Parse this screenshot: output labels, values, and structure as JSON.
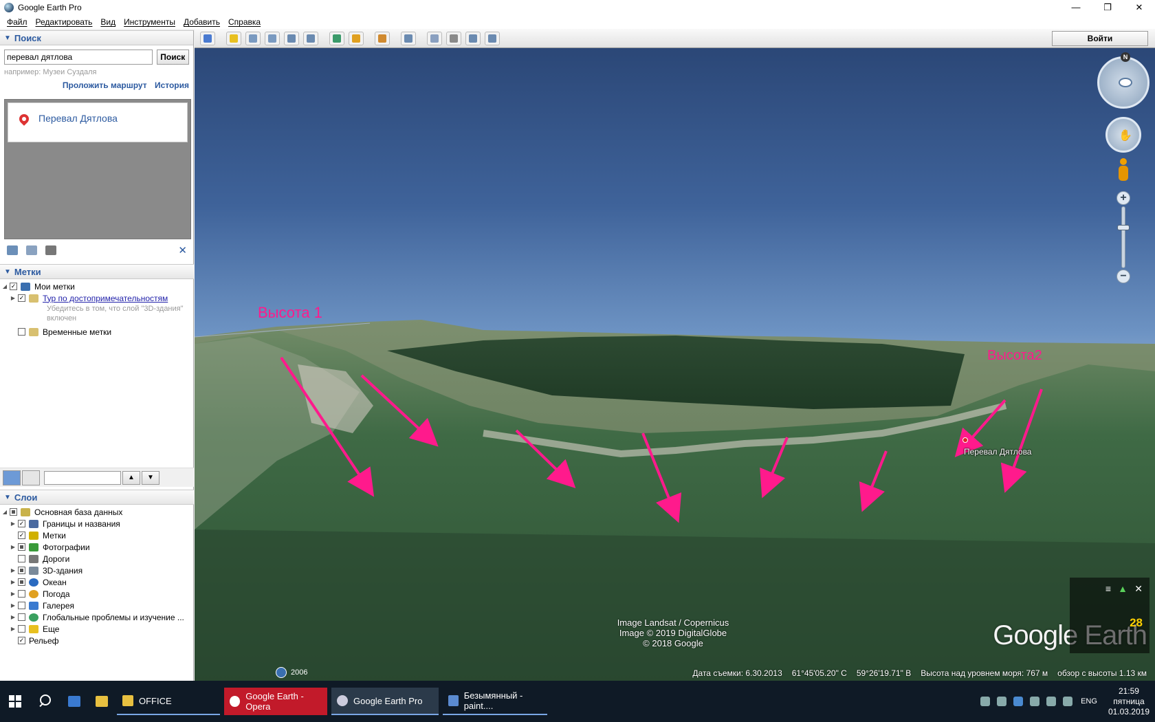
{
  "window": {
    "title": "Google Earth Pro",
    "controls": [
      "—",
      "❐",
      "✕"
    ]
  },
  "menu": [
    "Файл",
    "Редактировать",
    "Вид",
    "Инструменты",
    "Добавить",
    "Справка"
  ],
  "search": {
    "header": "Поиск",
    "query": "перевал дятлова",
    "button": "Поиск",
    "hint": "например: Музеи Суздаля",
    "link_route": "Проложить маршрут",
    "link_history": "История",
    "result": "Перевал Дятлова"
  },
  "places": {
    "header": "Метки",
    "my_places": "Мои метки",
    "tour_link": "Тур по достопримечательностям",
    "tour_note_1": "Убедитесь в том, что слой \"3D-здания\"",
    "tour_note_2": "включен",
    "temporary": "Временные метки"
  },
  "layers": {
    "header": "Слои",
    "items": [
      {
        "label": "Основная база данных",
        "icon": "database-icon",
        "color": "#c9b24a"
      },
      {
        "label": "Границы и названия",
        "icon": "borders-icon",
        "color": "#4a6aa0"
      },
      {
        "label": "Метки",
        "icon": "placemark-icon",
        "color": "#d0b000"
      },
      {
        "label": "Фотографии",
        "icon": "photo-icon",
        "color": "#3a9a3a"
      },
      {
        "label": "Дороги",
        "icon": "road-icon",
        "color": "#777777"
      },
      {
        "label": "3D-здания",
        "icon": "building-icon",
        "color": "#7a8a9a"
      },
      {
        "label": "Океан",
        "icon": "ocean-icon",
        "color": "#2a6ac0"
      },
      {
        "label": "Погода",
        "icon": "weather-icon",
        "color": "#e0a020"
      },
      {
        "label": "Галерея",
        "icon": "gallery-icon",
        "color": "#3a7ad0"
      },
      {
        "label": "Глобальные проблемы и изучение ...",
        "icon": "globe-icon",
        "color": "#3aa060"
      },
      {
        "label": "Еще",
        "icon": "more-icon",
        "color": "#e8c020"
      },
      {
        "label": "Рельеф",
        "icon": "",
        "color": ""
      }
    ]
  },
  "toolbar": {
    "signin": "Войти"
  },
  "map": {
    "annotation_1": "Высота 1",
    "annotation_2": "Высота2",
    "place_label": "Перевал Дятлова",
    "credit_1": "Image Landsat / Copernicus",
    "credit_2": "Image © 2019 DigitalGlobe",
    "credit_3": "© 2018 Google",
    "logo": "Google Earth",
    "historical_year": "2006",
    "compass_letter": "N",
    "mini_count": "28"
  },
  "status": {
    "date": "Дата съемки: 6.30.2013",
    "lat": "61°45'05.20\" С",
    "lon": "59°26'19.71\" В",
    "elevation": "Высота над уровнем моря:   767 м",
    "eye_alt": "обзор с высоты   1.13 км"
  },
  "taskbar": {
    "tasks": [
      "OFFICE",
      "Google Earth - Opera",
      "Google Earth Pro",
      "Безымянный - paint...."
    ],
    "lang": "ENG",
    "time": "21:59",
    "day": "пятница",
    "date": "01.03.2019"
  },
  "colors": {
    "accent": "#2c5aa0",
    "annotation": "#ff1a8c",
    "opera": "#c21a2a"
  }
}
